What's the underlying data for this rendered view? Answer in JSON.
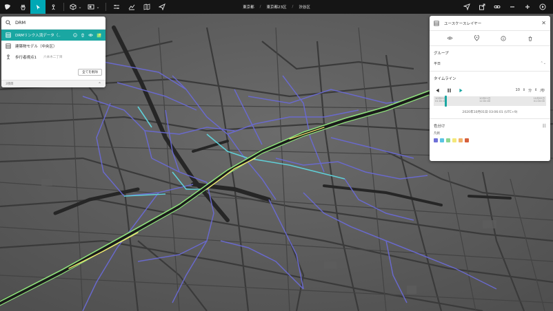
{
  "toolbar": {
    "breadcrumb": [
      "東京都",
      "東京都23区",
      "渋谷区"
    ]
  },
  "search": {
    "query": "DRM",
    "results": [
      {
        "label": "DRMリンク入流データ（..",
        "sub": "",
        "selected": true
      },
      {
        "label": "建築物モデル（中央区）",
        "sub": "",
        "selected": false
      },
      {
        "label": "歩行者視点1",
        "sub": "六本木二丁目",
        "selected": false
      }
    ],
    "delete_all_label": "全てを削除",
    "footer_label": "3項目"
  },
  "usecase": {
    "title": "ユースケースレイヤー",
    "group_label": "グループ",
    "group_value": "平日",
    "timeline_label": "タイムライン",
    "speed_value": "10",
    "speed_unit": "分",
    "speed_per": "/秒",
    "timeline_ticks": [
      {
        "date": "10月01日",
        "time": "01:00:00"
      },
      {
        "date": "10月01日",
        "time": "12:00:00"
      },
      {
        "date": "10月02日",
        "time": "01:00:00"
      }
    ],
    "current_time": "2020年10月01日 03:06:01 (UTC+9)",
    "colorize_label": "色分け",
    "legend_label": "凡例",
    "legend_colors": [
      "#6f70d8",
      "#59c4e3",
      "#8ed690",
      "#f4e87a",
      "#f2b36b",
      "#d6603c"
    ]
  },
  "colors": {
    "accent": "#00a8b5",
    "selected_row": "#1aa7a2",
    "road_dark": "#2b2b2b",
    "road_purple": "#6a6ad2",
    "road_cyan": "#60d0d8",
    "road_green": "#8fe27c",
    "road_yellow": "#f2e56e"
  }
}
